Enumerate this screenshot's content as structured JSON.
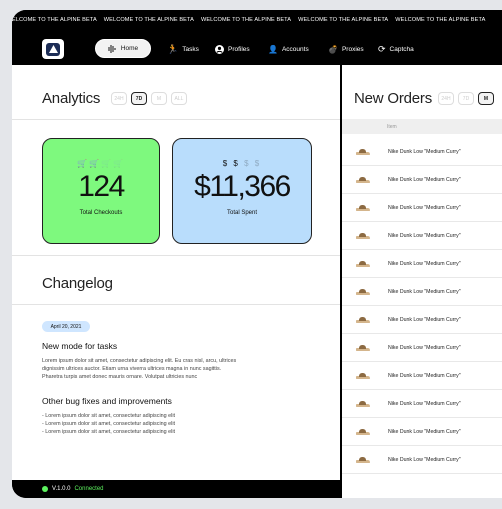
{
  "ticker": {
    "items": [
      "ELCOME TO THE ALPINE BETA",
      "WELCOME TO THE ALPINE BETA",
      "WELCOME TO THE ALPINE BETA",
      "WELCOME TO THE ALPINE BETA",
      "WELCOME TO THE ALPINE BETA"
    ]
  },
  "nav": {
    "home": "Home",
    "tasks": "Tasks",
    "profiles": "Profiles",
    "accounts": "Accounts",
    "proxies": "Proxies",
    "captcha": "Captcha"
  },
  "analytics": {
    "title": "Analytics",
    "ranges": [
      "24H",
      "7D",
      "M",
      "ALL"
    ],
    "active_range": "7D",
    "cards": [
      {
        "icons": "🛒 🛒 🛒 🛒",
        "value": "124",
        "label": "Total Checkouts",
        "color": "#7ef97e"
      },
      {
        "icons": "$ $ $ $",
        "value": "$11,366",
        "label": "Total Spent",
        "color": "#b9ddfc"
      }
    ]
  },
  "changelog": {
    "title": "Changelog",
    "date": "April 20, 2021",
    "heading1": "New mode for tasks",
    "body1_line1": "Lorem ipsum dolor sit amet, consectetur adipiscing elit. Eu cras nisl, arcu, ultrices",
    "body1_line2": "dignissim ultrices auctor. Etiam urna viverra ultrices magna in nunc sagittis.",
    "body1_line3": "Pharetra turpis amet donec mauris ornare. Volutpat ultricies nunc",
    "heading2": "Other bug fixes and improvements",
    "bullets": [
      "- Lorem ipsum dolor sit amet, consectetur adipiscing elit",
      "- Lorem ipsum dolor sit amet, consectetur adipiscing elit",
      "- Lorem ipsum dolor sit amet, consectetur adipiscing elit"
    ]
  },
  "status": {
    "version": "V.1.0.0",
    "state": "Connected"
  },
  "orders": {
    "title": "New Orders",
    "ranges": [
      "24H",
      "7D",
      "M"
    ],
    "active_range": "M",
    "column": "Item",
    "items": [
      "Nike Dunk Low \"Medium Curry\"",
      "Nike Dunk Low \"Medium Curry\"",
      "Nike Dunk Low \"Medium Curry\"",
      "Nike Dunk Low \"Medium Curry\"",
      "Nike Dunk Low \"Medium Curry\"",
      "Nike Dunk Low \"Medium Curry\"",
      "Nike Dunk Low \"Medium Curry\"",
      "Nike Dunk Low \"Medium Curry\"",
      "Nike Dunk Low \"Medium Curry\"",
      "Nike Dunk Low \"Medium Curry\"",
      "Nike Dunk Low \"Medium Curry\"",
      "Nike Dunk Low \"Medium Curry\""
    ]
  },
  "colors": {
    "accent_green": "#7ef97e",
    "accent_blue": "#b9ddfc",
    "status_dot": "#5cf25e"
  }
}
